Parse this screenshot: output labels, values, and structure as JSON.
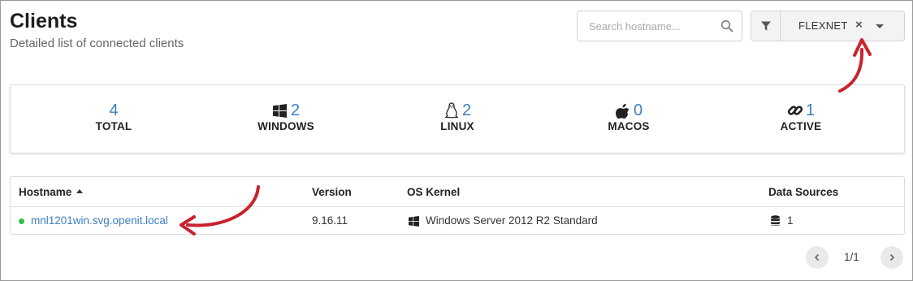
{
  "header": {
    "title": "Clients",
    "subtitle": "Detailed list of connected clients"
  },
  "search": {
    "placeholder": "Search hostname...",
    "value": "",
    "icon": "search-icon"
  },
  "filter": {
    "icon": "filter-icon",
    "value": "FLEXNET",
    "clear_label": "×"
  },
  "stats": [
    {
      "key": "total",
      "value": "4",
      "label": "TOTAL",
      "icon": ""
    },
    {
      "key": "windows",
      "value": "2",
      "label": "WINDOWS",
      "icon": "windows-icon"
    },
    {
      "key": "linux",
      "value": "2",
      "label": "LINUX",
      "icon": "linux-icon"
    },
    {
      "key": "macos",
      "value": "0",
      "label": "MACOS",
      "icon": "apple-icon"
    },
    {
      "key": "active",
      "value": "1",
      "label": "ACTIVE",
      "icon": "link-icon"
    }
  ],
  "table": {
    "columns": {
      "hostname": "Hostname",
      "version": "Version",
      "os_kernel": "OS Kernel",
      "data_sources": "Data Sources"
    },
    "sort": {
      "column": "hostname",
      "direction": "ascending"
    },
    "rows": [
      {
        "status": "online",
        "hostname": "mnl1201win.svg.openit.local",
        "version": "9.16.11",
        "os_icon": "windows-icon",
        "os_kernel": "Windows Server 2012 R2 Standard",
        "data_sources_icon": "database-icon",
        "data_sources": "1"
      }
    ]
  },
  "pagination": {
    "label": "1/1",
    "prev_icon": "chevron-left-icon",
    "next_icon": "chevron-right-icon"
  },
  "colors": {
    "accent": "#3c7fc3",
    "online": "#2dbd4e",
    "annotation_arrow": "#c8232e"
  }
}
